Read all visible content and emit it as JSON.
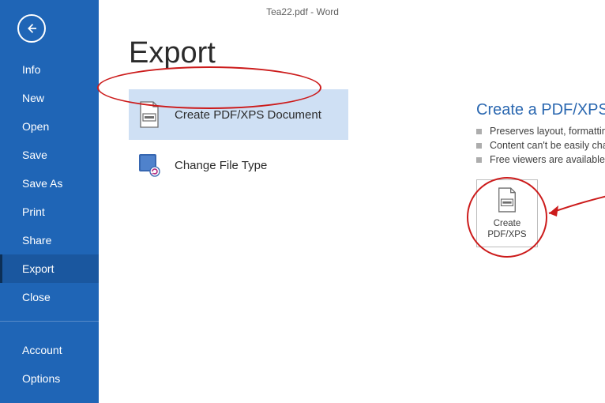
{
  "titlebar": "Tea22.pdf - Word",
  "sidebar": {
    "items": [
      {
        "label": "Info"
      },
      {
        "label": "New"
      },
      {
        "label": "Open"
      },
      {
        "label": "Save"
      },
      {
        "label": "Save As"
      },
      {
        "label": "Print"
      },
      {
        "label": "Share"
      },
      {
        "label": "Export",
        "active": true
      },
      {
        "label": "Close"
      }
    ],
    "footer": [
      {
        "label": "Account"
      },
      {
        "label": "Options"
      }
    ]
  },
  "page_title": "Export",
  "options": [
    {
      "label": "Create PDF/XPS Document",
      "selected": true
    },
    {
      "label": "Change File Type"
    }
  ],
  "detail": {
    "title": "Create a PDF/XPS Document",
    "bullets": [
      "Preserves layout, formatting, fonts, and images",
      "Content can't be easily changed",
      "Free viewers are available on the web"
    ],
    "button_line1": "Create",
    "button_line2": "PDF/XPS"
  }
}
